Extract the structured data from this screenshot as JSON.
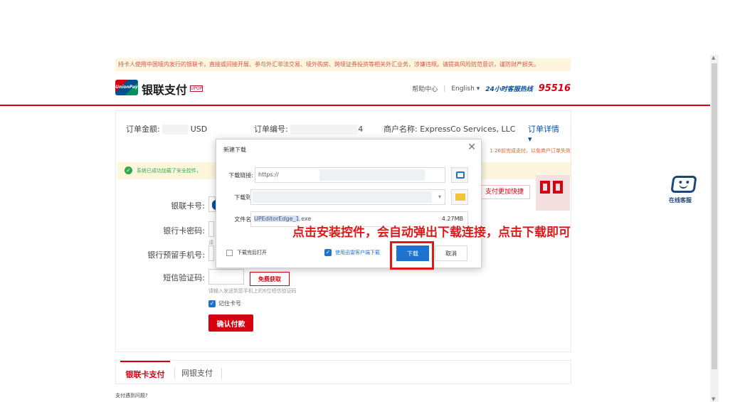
{
  "notice": "持卡人使用中国境内发行的银联卡，直接或间接开展、参与外汇非法交易、境外购房、跨境证券投资等相关外汇业务，涉嫌违规。请提高风险防范意识，谨防财产损失。",
  "header": {
    "logo_text": "UnionPay 银联",
    "brand": "银联支付",
    "badge": "UPOP",
    "help": "帮助中心",
    "language": "English",
    "hotline_label": "24小时客服热线",
    "hotline_number": "95516"
  },
  "order": {
    "amount_label": "订单金额:",
    "currency": "USD",
    "number_label": "订单编号:",
    "number_suffix": "4",
    "merchant_label": "商户名称:",
    "merchant_name": "ExpressCo Services, LLC",
    "detail_link": "订单详情",
    "note": "1.26前完成支付，以免商户订单失效"
  },
  "security_notice": "系统已成功加载了安全控件，",
  "form": {
    "card_label": "银联卡号:",
    "pin_label": "银行卡密码:",
    "pin_hint": "请",
    "phone_label": "银行预留手机号:",
    "sms_label": "短信验证码:",
    "sms_button": "免费获取",
    "sms_hint": "请输入发送到您手机上的6位短信验证码",
    "remember": "记住卡号",
    "pay_button": "确认付款",
    "fast_pay": "支付更加快捷"
  },
  "tabs": [
    "银联卡支付",
    "网银支付"
  ],
  "trouble": "支付遇到问题?",
  "customer_service": "在线客服",
  "dialog": {
    "title": "新建下载",
    "url_label": "下载链接:",
    "url_value": "https://",
    "dir_label": "下载到:",
    "filename_label": "文件名:",
    "filename_selected": "UPEditorEdge_1",
    "filename_ext": ".exe",
    "file_size": "4.27MB",
    "open_after": "下载完后打开",
    "use_client": "使用迅雷客户端下载",
    "download_button": "下载",
    "cancel_button": "取消"
  },
  "annotation": "点击安装控件，会自动弹出下载连接，点击下载即可",
  "colors": {
    "brand_red": "#d7000f",
    "link_blue": "#0b4f9c",
    "button_blue": "#1e72d0",
    "annotation_red": "#e01818"
  }
}
